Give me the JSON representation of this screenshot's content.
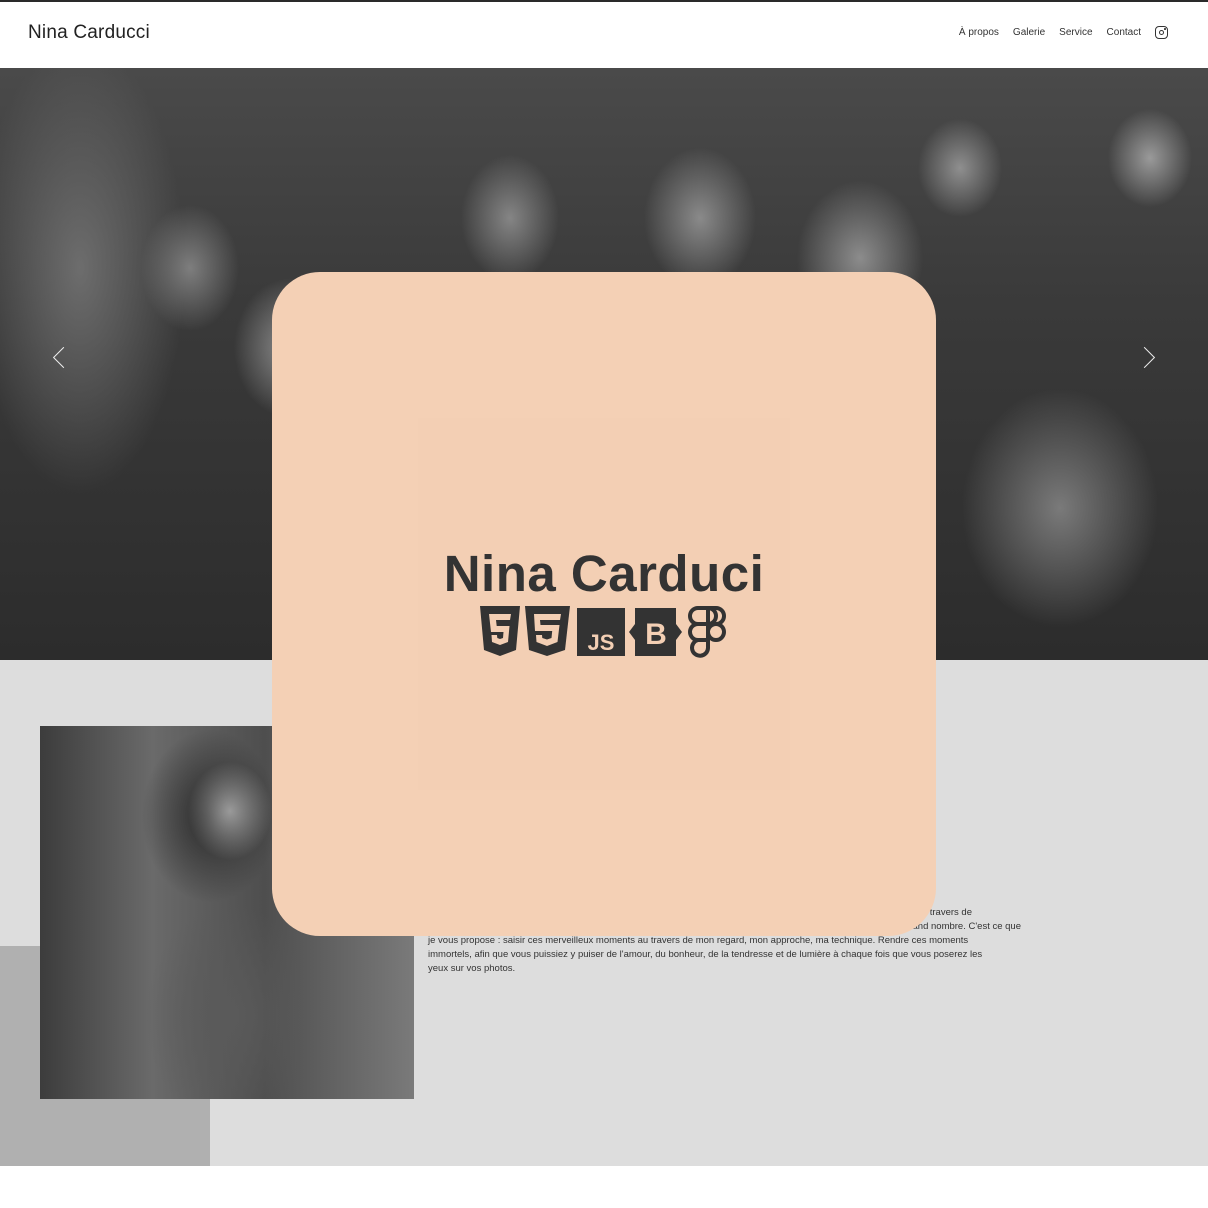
{
  "header": {
    "brand": "Nina Carducci",
    "nav": [
      "À propos",
      "Galerie",
      "Service",
      "Contact"
    ],
    "social_icon": "instagram-icon"
  },
  "hero": {
    "prev_icon": "chevron-left-icon",
    "next_icon": "chevron-right-icon",
    "image": "black-and-white concert crowd photo"
  },
  "about": {
    "text_lines": [
      "travers de",
      "grand nombre. C'est ce que",
      "je vous propose : saisir ces merveilleux moments au travers de mon regard, mon approche, ma technique. Rendre ces moments",
      "immortels, afin que vous puissiez y puiser de l'amour, du bonheur, de la tendresse et de lumière à chaque fois que vous poserez les",
      "yeux sur vos photos."
    ]
  },
  "modal": {
    "logo_title": "Nina Carduci",
    "logo_icons": [
      "html5-icon",
      "css3-icon",
      "javascript-icon",
      "bootstrap-icon",
      "figma-icon"
    ],
    "background_color": "#f4d0b5"
  }
}
